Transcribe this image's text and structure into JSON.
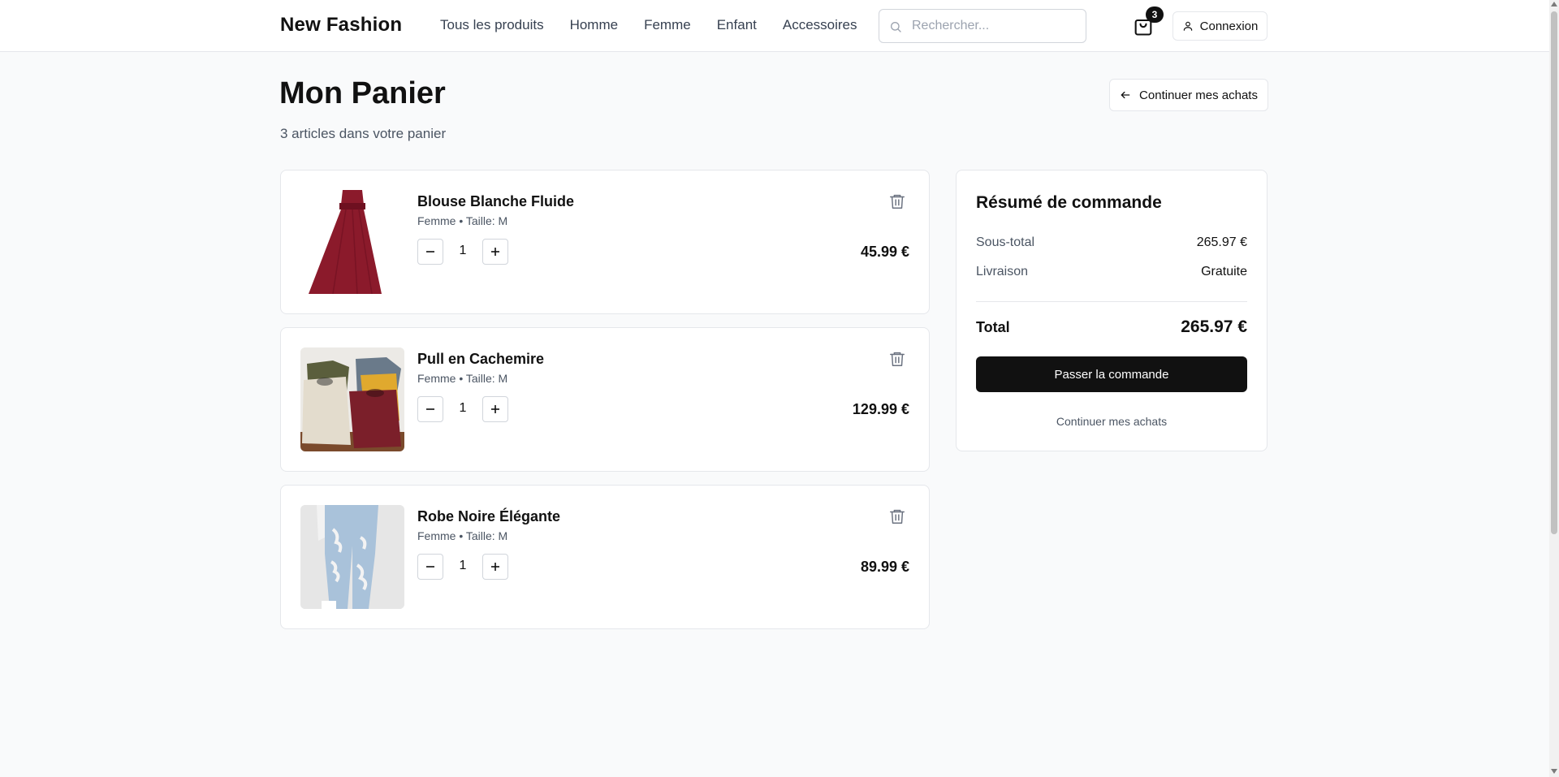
{
  "header": {
    "brand": "New Fashion",
    "nav": [
      "Tous les produits",
      "Homme",
      "Femme",
      "Enfant",
      "Accessoires"
    ],
    "search_placeholder": "Rechercher...",
    "cart_count": "3",
    "login_label": "Connexion"
  },
  "page": {
    "title": "Mon Panier",
    "subtitle": "3 articles dans votre panier",
    "continue_label": "Continuer mes achats"
  },
  "items": [
    {
      "name": "Blouse Blanche Fluide",
      "meta": "Femme • Taille: M",
      "qty": "1",
      "price": "45.99 €"
    },
    {
      "name": "Pull en Cachemire",
      "meta": "Femme • Taille: M",
      "qty": "1",
      "price": "129.99 €"
    },
    {
      "name": "Robe Noire Élégante",
      "meta": "Femme • Taille: M",
      "qty": "1",
      "price": "89.99 €"
    }
  ],
  "summary": {
    "title": "Résumé de commande",
    "subtotal_label": "Sous-total",
    "subtotal_value": "265.97 €",
    "shipping_label": "Livraison",
    "shipping_value": "Gratuite",
    "total_label": "Total",
    "total_value": "265.97 €",
    "checkout_label": "Passer la commande",
    "continue_label": "Continuer mes achats"
  },
  "colors": {
    "accent": "#111111",
    "border": "#e5e7eb",
    "background": "#f9fafb"
  }
}
